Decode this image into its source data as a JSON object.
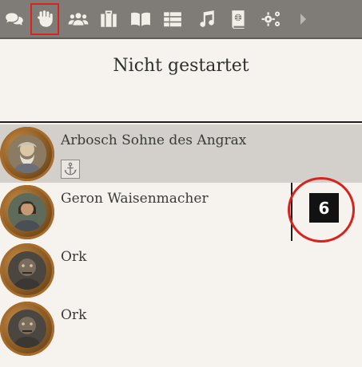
{
  "toolbar": {
    "buttons": [
      {
        "icon": "chat-icon",
        "active": false
      },
      {
        "icon": "fist-icon",
        "active": true
      },
      {
        "icon": "group-icon",
        "active": false
      },
      {
        "icon": "inventory-icon",
        "active": false
      },
      {
        "icon": "book-icon",
        "active": false
      },
      {
        "icon": "table-icon",
        "active": false
      },
      {
        "icon": "music-icon",
        "active": false
      },
      {
        "icon": "globe-book-icon",
        "active": false
      },
      {
        "icon": "settings-icon",
        "active": false
      }
    ],
    "more_icon": "chevron-right-icon",
    "active_outline_color": "#d9231e"
  },
  "panel": {
    "title": "Nicht gestartet"
  },
  "combatants": [
    {
      "name": "Arbosch Sohne des Angrax",
      "selected": true,
      "status_icon": "anchor-icon"
    },
    {
      "name": "Geron Waisenmacher",
      "selected": false,
      "initiative": "6"
    },
    {
      "name": "Ork",
      "selected": false
    },
    {
      "name": "Ork",
      "selected": false
    }
  ],
  "colors": {
    "toolbar": "#7f7b76",
    "paper": "#f6f3ee",
    "selected_row": "#d3d0cc",
    "annotation": "#d8221d"
  }
}
